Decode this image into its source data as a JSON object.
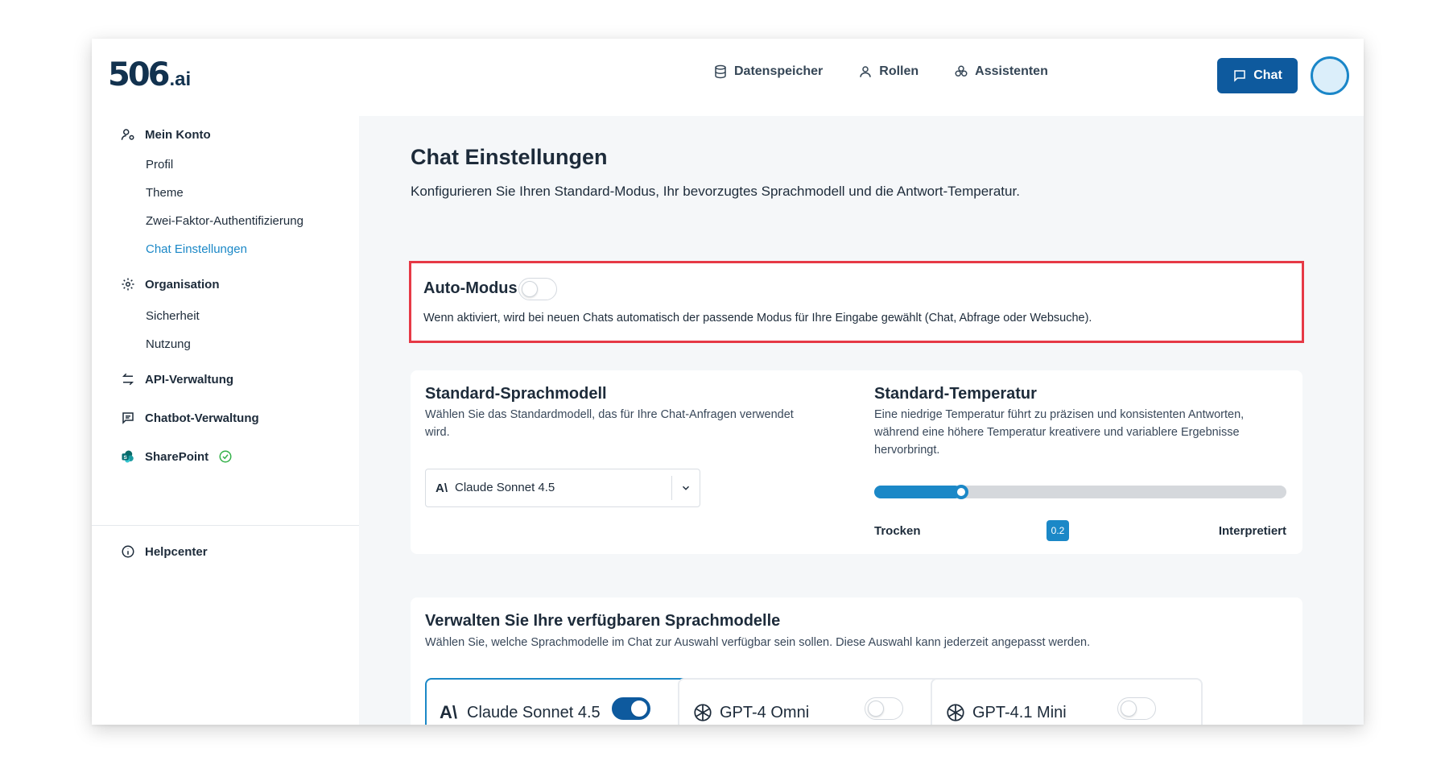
{
  "header": {
    "logo_main": "506",
    "logo_suffix": ".ai",
    "nav": [
      {
        "label": "Datenspeicher",
        "icon": "database-icon"
      },
      {
        "label": "Rollen",
        "icon": "user-icon"
      },
      {
        "label": "Assistenten",
        "icon": "assistants-icon"
      }
    ],
    "chat_button": "Chat"
  },
  "sidebar": {
    "mein_konto": "Mein Konto",
    "profil": "Profil",
    "theme": "Theme",
    "two_factor": "Zwei-Faktor-Authentifizierung",
    "chat_einstellungen": "Chat Einstellungen",
    "organisation": "Organisation",
    "sicherheit": "Sicherheit",
    "nutzung": "Nutzung",
    "api": "API-Verwaltung",
    "chatbot": "Chatbot-Verwaltung",
    "sharepoint": "SharePoint",
    "helpcenter": "Helpcenter"
  },
  "main": {
    "title": "Chat Einstellungen",
    "subtitle": "Konfigurieren Sie Ihren Standard-Modus, Ihr bevorzugtes Sprachmodell und die Antwort-Temperatur.",
    "auto_mode": {
      "title": "Auto-Modus",
      "enabled": false,
      "description": "Wenn aktiviert, wird bei neuen Chats automatisch der passende Modus für Ihre Eingabe gewählt (Chat, Abfrage oder Websuche)."
    },
    "default_model": {
      "title": "Standard-Sprachmodell",
      "description": "Wählen Sie das Standardmodell, das für Ihre Chat-Anfragen verwendet wird.",
      "selected": "Claude Sonnet 4.5",
      "selected_icon": "A\\"
    },
    "temperature": {
      "title": "Standard-Temperatur",
      "description": "Eine niedrige Temperatur führt zu präzisen und konsistenten Antworten, während eine höhere Temperatur kreativere und variablere Ergebnisse hervorbringt.",
      "value": 0.2,
      "value_label": "0.2",
      "min_label": "Trocken",
      "max_label": "Interpretiert"
    },
    "models": {
      "title": "Verwalten Sie Ihre verfügbaren Sprachmodelle",
      "description": "Wählen Sie, welche Sprachmodelle im Chat zur Auswahl verfügbar sein sollen. Diese Auswahl kann jederzeit angepasst werden.",
      "items": [
        {
          "name": "Claude Sonnet 4.5",
          "icon": "A\\",
          "enabled": true
        },
        {
          "name": "GPT-4 Omni",
          "icon": "openai-icon",
          "enabled": false
        },
        {
          "name": "GPT-4.1 Mini",
          "icon": "openai-icon",
          "enabled": false
        }
      ]
    }
  },
  "colors": {
    "accent": "#1b88c7",
    "primary": "#0e5a9e",
    "highlight": "#e63946"
  }
}
